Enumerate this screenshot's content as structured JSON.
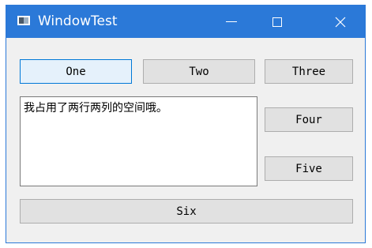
{
  "window": {
    "title": "WindowTest"
  },
  "buttons": {
    "one": "One",
    "two": "Two",
    "three": "Three",
    "four": "Four",
    "five": "Five",
    "six": "Six"
  },
  "text_edit": {
    "value": "我占用了两行两列的空间哦。"
  },
  "colors": {
    "titlebar": "#2b79d8",
    "window_bg": "#f0f0f0",
    "button_bg": "#e1e1e1",
    "focused_border": "#0078d7"
  },
  "icons": [
    "app-icon",
    "minimize-icon",
    "maximize-icon",
    "close-icon"
  ]
}
